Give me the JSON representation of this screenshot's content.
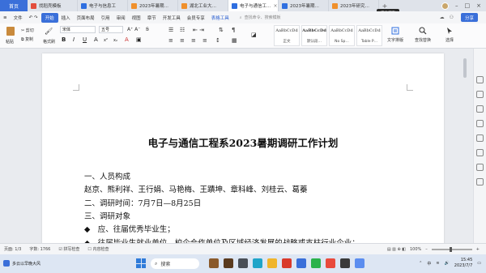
{
  "tabbar": {
    "home": "首页",
    "tabs": [
      {
        "label": "找稻壳模板",
        "color": "#e34d3c"
      },
      {
        "label": "电子与信息工",
        "color": "#2f6fe0"
      },
      {
        "label": "2023年暑期…",
        "color": "#f0902b"
      },
      {
        "label": "湖北工业大…",
        "color": "#f0902b"
      },
      {
        "label": "电子与通信工…",
        "color": "#2f6fe0",
        "active": true
      },
      {
        "label": "2023年暑期…",
        "color": "#2f6fe0"
      },
      {
        "label": "2023年研究…",
        "color": "#f0902b"
      }
    ],
    "plus": "+",
    "tooltip": "活动调查"
  },
  "menu": {
    "file": "文件",
    "items": [
      "开始",
      "插入",
      "页面布局",
      "引用",
      "审阅",
      "视图",
      "章节",
      "开发工具",
      "会员专享",
      "表格工具"
    ],
    "search_placeholder": "查找命令、搜索模板",
    "share": "分享"
  },
  "ribbon": {
    "paste": "粘贴",
    "cut": "剪切",
    "copy": "复制",
    "format_painter": "格式刷",
    "font": "宋体",
    "size": "五号",
    "styles": [
      {
        "sample": "AaBbCcDd",
        "name": "正文"
      },
      {
        "sample": "AaBbCcDd",
        "name": "默认段…"
      },
      {
        "sample": "AaBbCcDd",
        "name": "No Sp…"
      },
      {
        "sample": "AaBbCcDd",
        "name": "Table P…"
      }
    ],
    "text_layout": "文字排版",
    "find_replace": "查找替换",
    "select": "选择"
  },
  "document": {
    "title": "电子与通信工程系2023暑期调研工作计划",
    "lines": [
      "一、人员构成",
      "赵京、熊利祥、王行娟、马艳梅、王蹟坤、章科峰、刘桂云、葛蓁",
      "二、调研时间：7月7日—8月25日",
      "三、调研对象",
      "◆　应、往届优秀毕业生；",
      "◆　往届毕业生就业单位、校企合作单位及区域经济发展的战略或支柱行业企业；"
    ]
  },
  "statusbar": {
    "page": "页面: 1/3",
    "words": "字数: 1766",
    "spell": "拼写检查",
    "content_check": "内容检查",
    "zoom": "100%"
  },
  "taskbar": {
    "weather": "多云以早晚大风",
    "search": "搜索",
    "time": "15:45",
    "date": "2023/7/7",
    "lang": "中"
  }
}
